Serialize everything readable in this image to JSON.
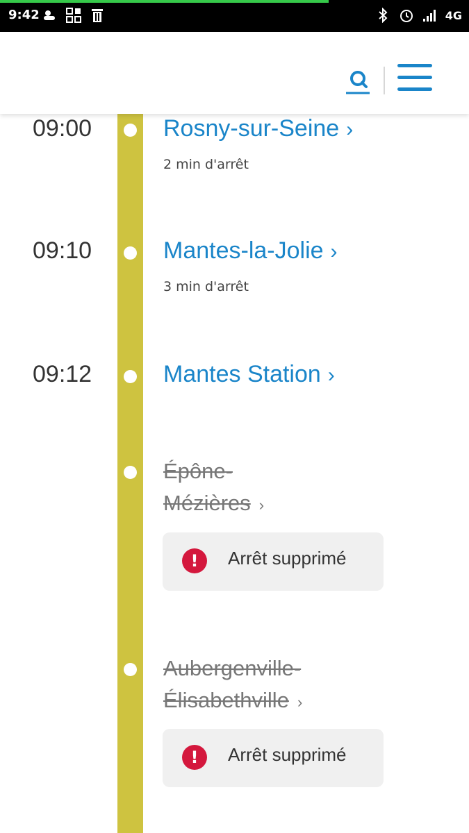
{
  "status_bar": {
    "time": "9:42",
    "network": "4G",
    "icons_left": [
      "weather-icon",
      "qr-icon",
      "trash-icon"
    ],
    "icons_right": [
      "bluetooth-icon",
      "alarm-icon",
      "signal-icon"
    ]
  },
  "header": {
    "icons": [
      "search-icon",
      "menu-icon"
    ],
    "accent_color": "#1a85c9"
  },
  "timeline": {
    "line_color": "#cec340",
    "stops": [
      {
        "time": "09:00",
        "name": "Rosny-sur-Seine",
        "sub": "2 min d'arrêt"
      },
      {
        "time": "09:10",
        "name": "Mantes-la-Jolie",
        "sub": "3 min d'arrêt"
      },
      {
        "time": "09:12",
        "name": "Mantes Station"
      }
    ],
    "cancelled": [
      {
        "name_line1": "Épône-",
        "name_line2": "Mézières",
        "alert": "Arrêt supprimé"
      },
      {
        "name_line1": "Aubergenville-",
        "name_line2": "Élisabethville",
        "alert": "Arrêt supprimé"
      }
    ],
    "chevron": "›",
    "alert_color": "#d4183d"
  }
}
